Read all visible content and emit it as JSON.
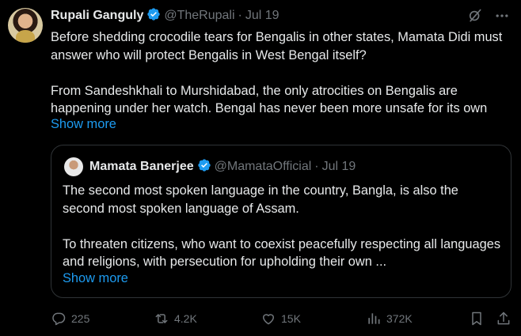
{
  "tweet": {
    "author_name": "Rupali Ganguly",
    "handle": "@TheRupali",
    "separator": "·",
    "date": "Jul 19",
    "paragraphs": [
      "Before shedding crocodile tears for Bengalis in other states, Mamata Didi must answer who will protect Bengalis in West Bengal itself?",
      "From Sandeshkhali to Murshidabad, the only atrocities on Bengalis are happening under her watch. Bengal has never been more unsafe for its own"
    ],
    "show_more": "Show more"
  },
  "quote": {
    "author_name": "Mamata Banerjee",
    "handle": "@MamataOfficial",
    "separator": "·",
    "date": "Jul 19",
    "paragraphs": [
      "The second most spoken language in the country, Bangla, is also the second most spoken language of Assam.",
      "To threaten citizens, who want to coexist peacefully respecting all languages and religions, with persecution for upholding their own ..."
    ],
    "show_more": "Show more"
  },
  "actions": {
    "replies": "225",
    "reposts": "4.2K",
    "likes": "15K",
    "views": "372K"
  },
  "icons": {
    "verified_badge": "verified-badge-icon",
    "grok": "grok-icon",
    "more": "more-icon",
    "reply": "reply-icon",
    "repost": "repost-icon",
    "like": "heart-icon",
    "views": "views-icon",
    "bookmark": "bookmark-icon",
    "share": "share-icon"
  },
  "colors": {
    "background": "#000000",
    "text": "#e7e9ea",
    "muted": "#71767b",
    "link": "#1d9bf0",
    "verified": "#1d9bf0",
    "border": "#2f3336"
  }
}
